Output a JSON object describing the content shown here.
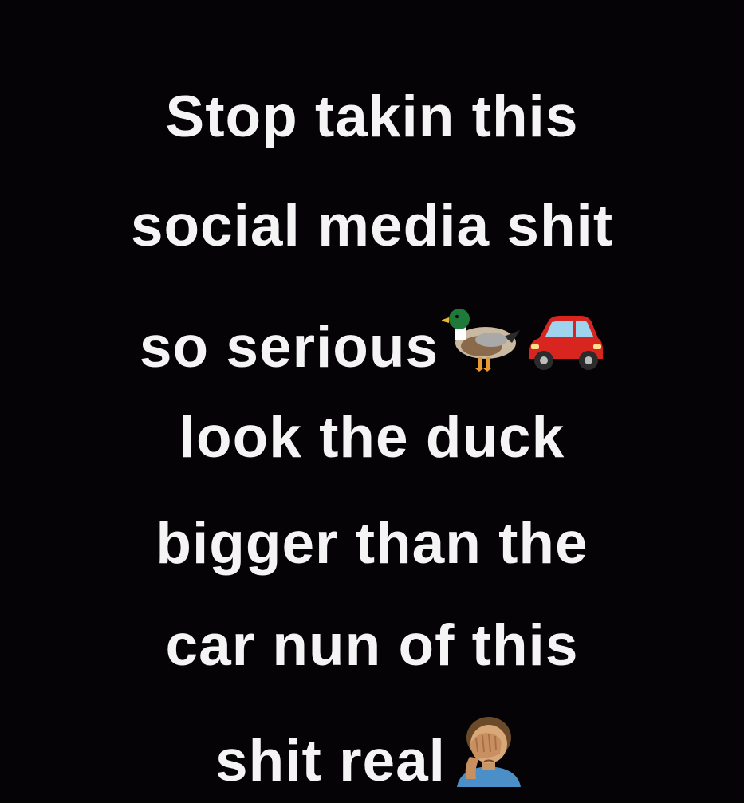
{
  "meme": {
    "lines": [
      "Stop takin this",
      "social media shit",
      "so serious",
      "look the duck",
      "bigger than the",
      "car nun of this",
      "shit real"
    ],
    "emoji_after_line_3": [
      "duck-icon",
      "car-icon"
    ],
    "emoji_after_line_7": [
      "facepalm-man-icon"
    ],
    "colors": {
      "background": "#060306",
      "text": "#f4f4f4"
    }
  }
}
